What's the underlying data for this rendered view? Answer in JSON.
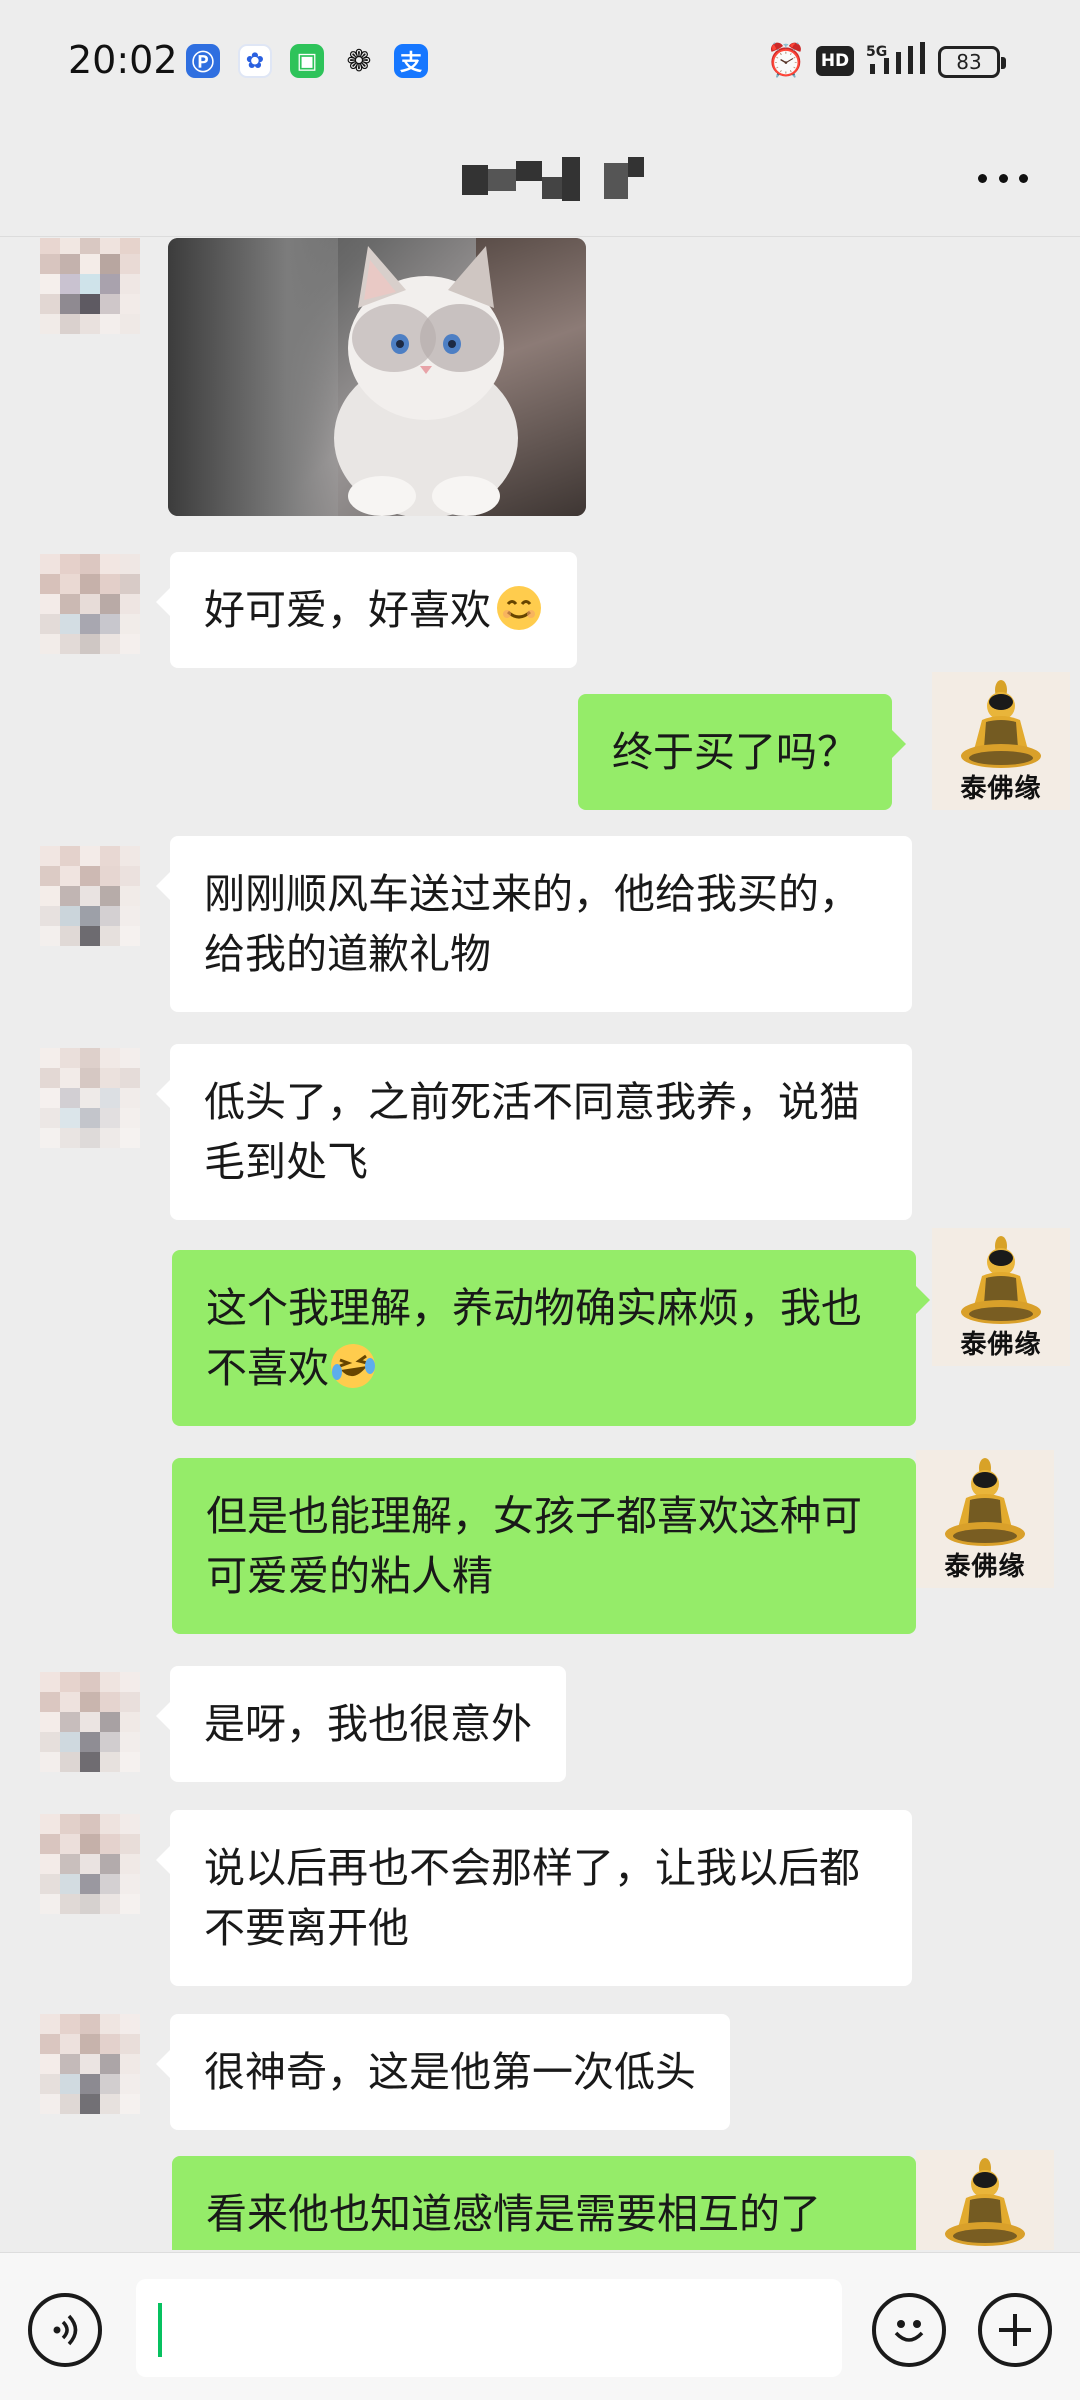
{
  "status_bar": {
    "time": "20:02",
    "app_icons": [
      "paypal-like-app-icon",
      "baidu-icon",
      "messages-icon",
      "wechat-icon",
      "alipay-icon"
    ],
    "network": "5G",
    "hd_label": "HD",
    "battery": "83"
  },
  "title_bar": {
    "title_blurred": true,
    "more_icon": "more-dots-icon"
  },
  "chat": {
    "partner_avatar": "pixelated-avatar",
    "my_avatar_caption": "泰佛缘",
    "colors": {
      "my_bubble": "#95ec69",
      "their_bubble": "#ffffff",
      "background": "#ededed"
    },
    "messages": [
      {
        "side": "left",
        "type": "image",
        "description_icon": "cat-photo"
      },
      {
        "side": "left",
        "text": "好可爱，好喜欢",
        "emoji": "smile-emoji"
      },
      {
        "side": "right",
        "text": "终于买了吗？"
      },
      {
        "side": "left",
        "text": "刚刚顺风车送过来的，他给我买的，给我的道歉礼物"
      },
      {
        "side": "left",
        "text": "低头了，之前死活不同意我养，说猫毛到处飞"
      },
      {
        "side": "right",
        "text": "这个我理解，养动物确实麻烦，我也不喜欢",
        "emoji": "laugh-cry-emoji"
      },
      {
        "side": "right",
        "text": "但是也能理解，女孩子都喜欢这种可可爱爱的粘人精"
      },
      {
        "side": "left",
        "text": "是呀，我也很意外"
      },
      {
        "side": "left",
        "text": "说以后再也不会那样了，让我以后都不要离开他"
      },
      {
        "side": "left",
        "text": "很神奇，这是他第一次低头"
      },
      {
        "side": "right",
        "text": "看来他也知道感情是需要相互的了"
      }
    ]
  },
  "input_bar": {
    "voice_icon": "voice-icon",
    "emoji_icon": "emoji-icon",
    "plus_icon": "plus-icon",
    "text_value": ""
  }
}
